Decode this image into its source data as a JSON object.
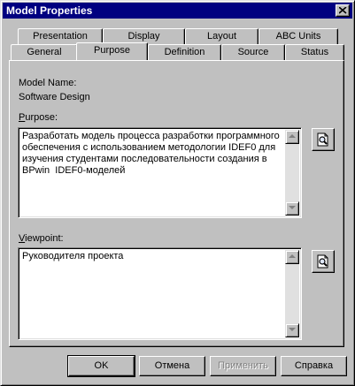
{
  "window": {
    "title": "Model Properties"
  },
  "tabs_back": [
    {
      "label": "Presentation"
    },
    {
      "label": "Display"
    },
    {
      "label": "Layout"
    },
    {
      "label": "ABC Units"
    }
  ],
  "tabs_front": [
    {
      "label": "General"
    },
    {
      "label": "Purpose"
    },
    {
      "label": "Definition"
    },
    {
      "label": "Source"
    },
    {
      "label": "Status"
    }
  ],
  "active_tab": "Purpose",
  "model": {
    "name_label": "Model Name:",
    "name_value": "Software Design"
  },
  "purpose": {
    "label_mnemonic": "P",
    "label_rest": "urpose:",
    "text": "Разработать модель процесса разработки программного обеспечения с использованием методологии IDEF0 для изучения студентами последовательности создания в BPwin  IDEF0-моделей"
  },
  "viewpoint": {
    "label_mnemonic": "V",
    "label_rest": "iewpoint:",
    "text": "Руководителя проекта"
  },
  "buttons": {
    "ok": "OK",
    "cancel": "Отмена",
    "apply": "Применить",
    "help": "Справка"
  },
  "icons": {
    "close": "close-icon",
    "lookup": "magnifier-document-icon",
    "scroll_up": "arrow-up-icon",
    "scroll_down": "arrow-down-icon"
  },
  "colors": {
    "titlebar": "#000080",
    "face": "#c0c0c0"
  }
}
